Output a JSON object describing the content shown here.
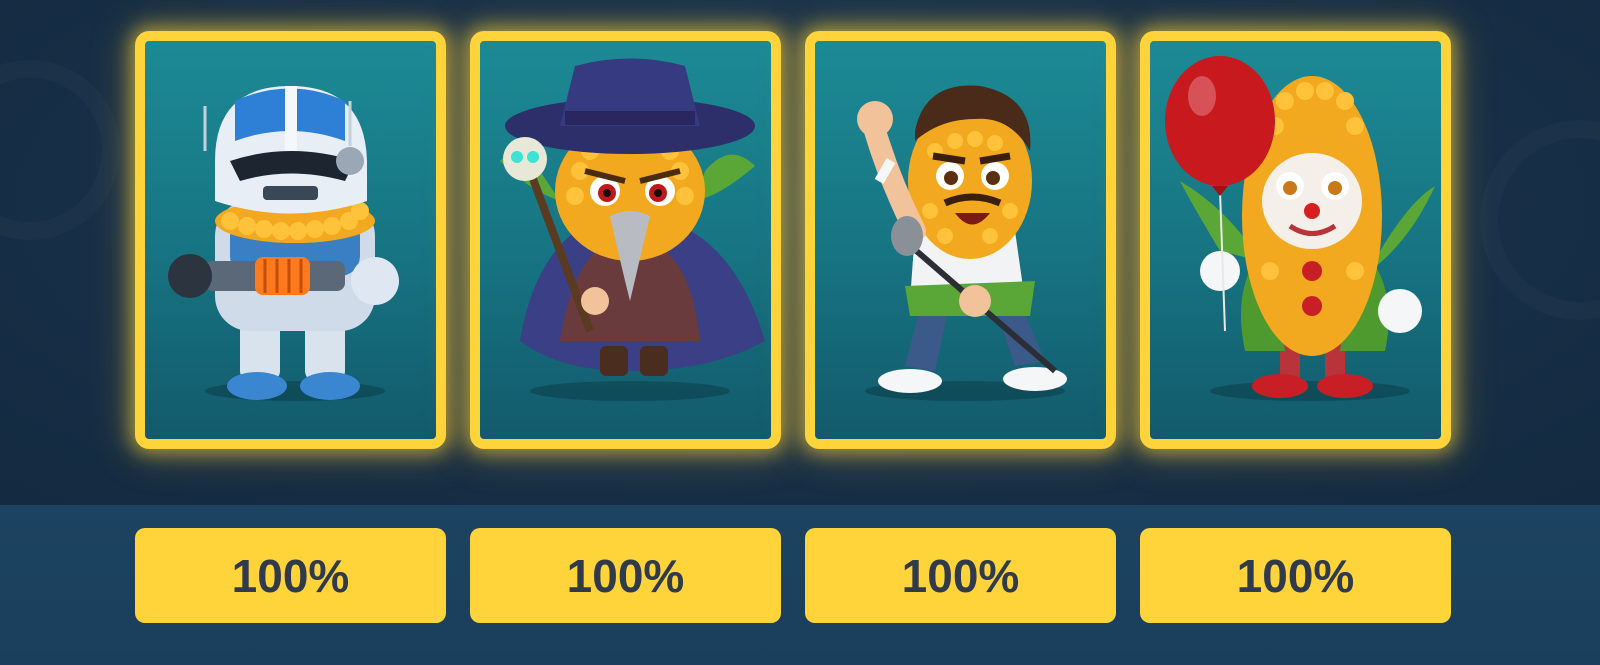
{
  "cards": [
    {
      "character": "corn-trooper-icon",
      "multiplier": "100%"
    },
    {
      "character": "corn-plague-doctor-icon",
      "multiplier": "100%"
    },
    {
      "character": "corn-rock-singer-icon",
      "multiplier": "100%"
    },
    {
      "character": "corn-clown-icon",
      "multiplier": "100%"
    }
  ],
  "colors": {
    "card_border": "#ffd43b",
    "card_bg": "#177381",
    "button_bg": "#ffd43b",
    "button_text": "#2f3a4a",
    "page_bg": "#17304a"
  }
}
